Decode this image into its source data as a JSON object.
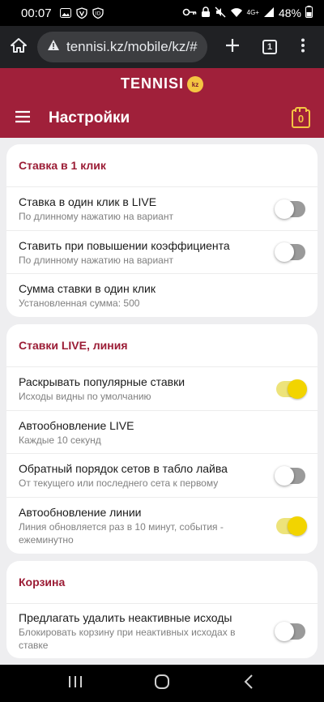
{
  "status_bar": {
    "time": "00:07",
    "network": "4G+",
    "battery": "48%"
  },
  "browser": {
    "url": "tennisi.kz/mobile/kz/#",
    "tab_count": "1"
  },
  "app": {
    "brand": "TENNISI",
    "brand_badge": "kz",
    "page_title": "Настройки",
    "basket_count": "0"
  },
  "sections": {
    "oneclick": {
      "title": "Ставка в 1 клик",
      "rows": [
        {
          "title": "Ставка в один клик в LIVE",
          "subtitle": "По длинному нажатию на вариант",
          "toggle": false
        },
        {
          "title": "Ставить при повышении коэффициента",
          "subtitle": "По длинному нажатию на вариант",
          "toggle": false
        },
        {
          "title": "Сумма ставки в один клик",
          "subtitle": "Установленная сумма: 500"
        }
      ]
    },
    "live": {
      "title": "Ставки LIVE, линия",
      "rows": [
        {
          "title": "Раскрывать популярные ставки",
          "subtitle": "Исходы видны по умолчанию",
          "toggle": true
        },
        {
          "title": "Автообновление LIVE",
          "subtitle": "Каждые 10 секунд"
        },
        {
          "title": "Обратный порядок сетов в табло лайва",
          "subtitle": "От текущего или последнего сета к первому",
          "toggle": false
        },
        {
          "title": "Автообновление линии",
          "subtitle": "Линия обновляется раз в 10 минут, события - ежеминутно",
          "toggle": true
        }
      ]
    },
    "basket": {
      "title": "Корзина",
      "rows": [
        {
          "title": "Предлагать удалить неактивные исходы",
          "subtitle": "Блокировать корзину при неактивных исходах в ставке",
          "toggle": false
        }
      ]
    }
  },
  "colors": {
    "brand": "#a0203a",
    "section_title": "#9b1c35",
    "toggle_on": "#f2d400",
    "toggle_off": "#9a9a9a"
  },
  "icons": [
    "photo-icon",
    "vpn-key-icon",
    "shield-icon",
    "alarm-icon",
    "lock-icon",
    "mute-icon",
    "wifi-icon",
    "signal-icon",
    "battery-icon",
    "home-icon",
    "info-icon",
    "plus-icon",
    "menu-dots-icon",
    "hamburger-icon",
    "basket-icon",
    "recents-icon",
    "nav-home-icon",
    "back-icon"
  ]
}
